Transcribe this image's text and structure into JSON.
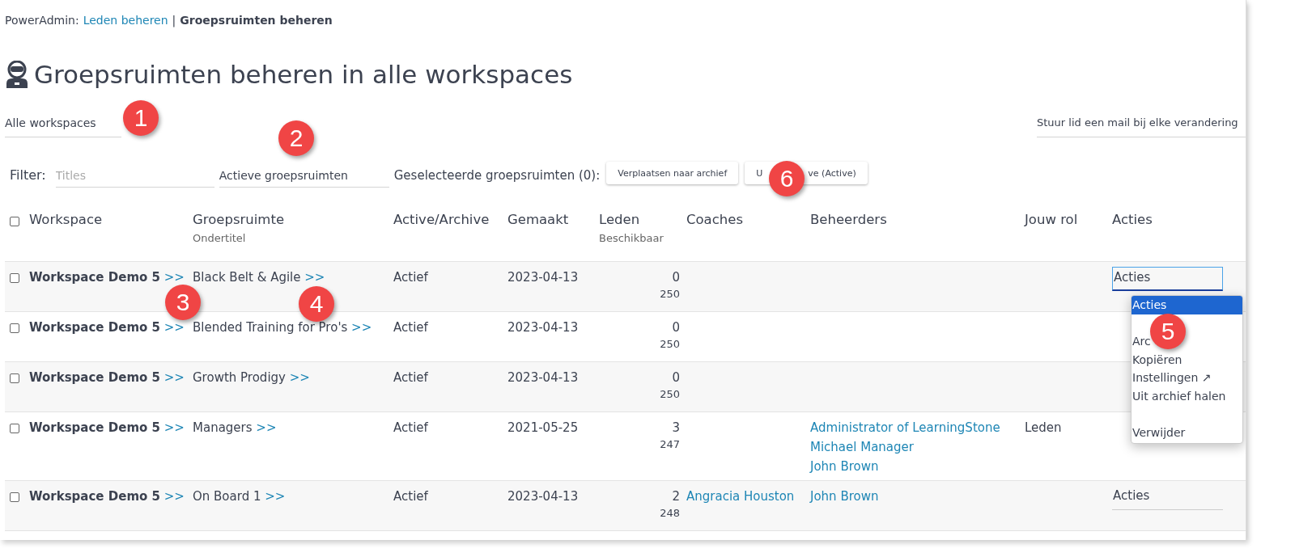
{
  "breadcrumb": {
    "prefix": "PowerAdmin:",
    "link": "Leden beheren",
    "separator": "|",
    "current": "Groepsruimten beheren"
  },
  "title": "Groepsruimten beheren in alle workspaces",
  "workspace_select": {
    "value": "Alle workspaces"
  },
  "mail_option": {
    "value": "Stuur lid een mail bij elke verandering"
  },
  "filter": {
    "label": "Filter:",
    "placeholder": "Titles",
    "status_select": "Actieve groepsruimten",
    "selected_label": "Geselecteerde groepsruimten (0):"
  },
  "bulk_buttons": [
    {
      "label_parts": [
        "Verplaatsen naar archief"
      ]
    },
    {
      "label_parts": [
        "U",
        "ve (Active)"
      ]
    }
  ],
  "table": {
    "columns": [
      {
        "label": "Workspace"
      },
      {
        "label": "Groepsruimte",
        "sub": "Ondertitel"
      },
      {
        "label": "Active/Archive"
      },
      {
        "label": "Gemaakt"
      },
      {
        "label": "Leden",
        "sub": "Beschikbaar"
      },
      {
        "label": "Coaches"
      },
      {
        "label": "Beheerders"
      },
      {
        "label": "Jouw rol"
      },
      {
        "label": "Acties"
      }
    ],
    "header_checked": false,
    "rows": [
      {
        "checked": false,
        "workspace": "Workspace Demo 5",
        "workspace_link": ">>",
        "group": "Black Belt & Agile",
        "group_link": ">>",
        "status": "Actief",
        "created": "2023-04-13",
        "members": "0",
        "available": "250",
        "coaches": [],
        "managers": [],
        "role": null,
        "action": {
          "value": "Acties",
          "focused": true
        }
      },
      {
        "checked": false,
        "workspace": "Workspace Demo 5",
        "workspace_link": ">>",
        "group": "Blended Training for Pro's",
        "group_link": ">>",
        "status": "Actief",
        "created": "2023-04-13",
        "members": "0",
        "available": "250",
        "coaches": [],
        "managers": [],
        "role": null,
        "action": null
      },
      {
        "checked": false,
        "workspace": "Workspace Demo 5",
        "workspace_link": ">>",
        "group": "Growth Prodigy",
        "group_link": ">>",
        "status": "Actief",
        "created": "2023-04-13",
        "members": "0",
        "available": "250",
        "coaches": [],
        "managers": [],
        "role": null,
        "action": null
      },
      {
        "checked": false,
        "workspace": "Workspace Demo 5",
        "workspace_link": ">>",
        "group": "Managers",
        "group_link": ">>",
        "status": "Actief",
        "created": "2021-05-25",
        "members": "3",
        "available": "247",
        "coaches": [],
        "managers": [
          "Administrator of LearningStone",
          "Michael Manager",
          "John Brown"
        ],
        "role": "Leden",
        "action": null
      },
      {
        "checked": false,
        "workspace": "Workspace Demo 5",
        "workspace_link": ">>",
        "group": "On Board 1",
        "group_link": ">>",
        "status": "Actief",
        "created": "2023-04-13",
        "members": "2",
        "available": "248",
        "coaches": [
          "Angracia Houston"
        ],
        "managers": [
          "John Brown"
        ],
        "role": null,
        "action": {
          "value": "Acties",
          "focused": false
        }
      }
    ]
  },
  "action_menu": {
    "options": [
      {
        "kind": "option",
        "label": "Acties",
        "selected": true
      },
      {
        "kind": "blank"
      },
      {
        "kind": "option",
        "label": "Arc",
        "selected": false
      },
      {
        "kind": "option",
        "label": "Kopiëren",
        "selected": false
      },
      {
        "kind": "option",
        "label": "Instellingen ↗",
        "selected": false
      },
      {
        "kind": "option",
        "label": "Uit archief halen",
        "selected": false
      },
      {
        "kind": "blank"
      },
      {
        "kind": "option",
        "label": "Verwijder",
        "selected": false
      }
    ]
  },
  "callouts": [
    {
      "label": "1"
    },
    {
      "label": "2"
    },
    {
      "label": "3"
    },
    {
      "label": "4"
    },
    {
      "label": "5"
    },
    {
      "label": "6"
    }
  ]
}
